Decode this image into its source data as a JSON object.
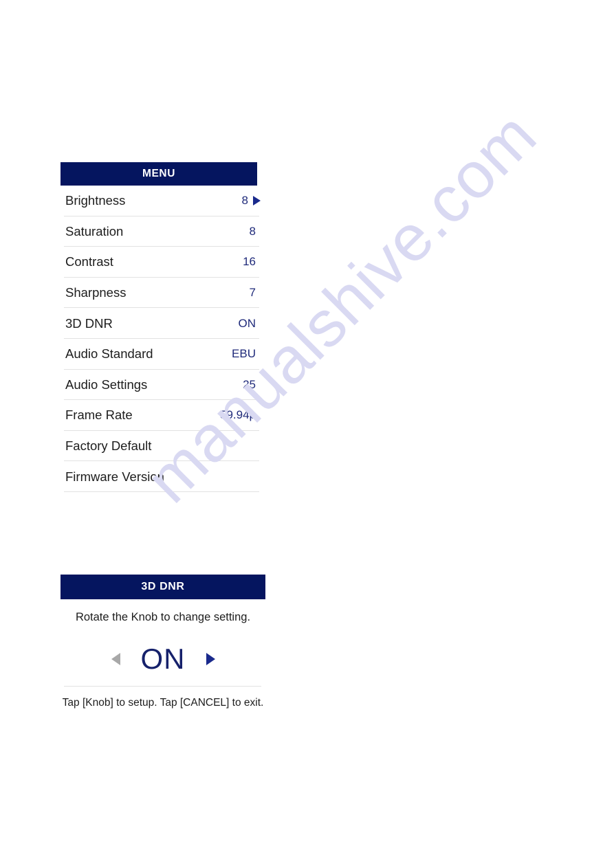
{
  "watermark": {
    "text": "manualshive.com"
  },
  "menu_panel": {
    "title": "MENU",
    "rows": [
      {
        "label": "Brightness",
        "value": "8",
        "has_caret": true
      },
      {
        "label": "Saturation",
        "value": "8",
        "has_caret": false
      },
      {
        "label": "Contrast",
        "value": "16",
        "has_caret": false
      },
      {
        "label": "Sharpness",
        "value": "7",
        "has_caret": false
      },
      {
        "label": "3D DNR",
        "value": "ON",
        "has_caret": false
      },
      {
        "label": "Audio Standard",
        "value": "EBU",
        "has_caret": false
      },
      {
        "label": "Audio Settings",
        "value": "25",
        "has_caret": false
      },
      {
        "label": "Frame Rate",
        "value": "59.94p",
        "has_caret": false
      },
      {
        "label": "Factory Default",
        "value": "",
        "has_caret": false
      },
      {
        "label": "Firmware Version",
        "value": "",
        "has_caret": false
      }
    ]
  },
  "dnr_panel": {
    "title": "3D DNR",
    "hint": "Rotate the Knob to change setting.",
    "value": "ON",
    "prev_arrow": "left-arrow-icon",
    "next_arrow": "right-arrow-icon",
    "footer": "Tap [Knob] to setup. Tap [CANCEL] to exit."
  },
  "colors": {
    "header_navy": "#05155f",
    "value_blue": "#1f2a7a",
    "caret_blue": "#1a2a8c",
    "arrow_disabled_grey": "#a8a8a8",
    "divider_grey": "#e2e2e2",
    "watermark_lavender": "#d9d9f2",
    "page_background": "#ffffff"
  }
}
